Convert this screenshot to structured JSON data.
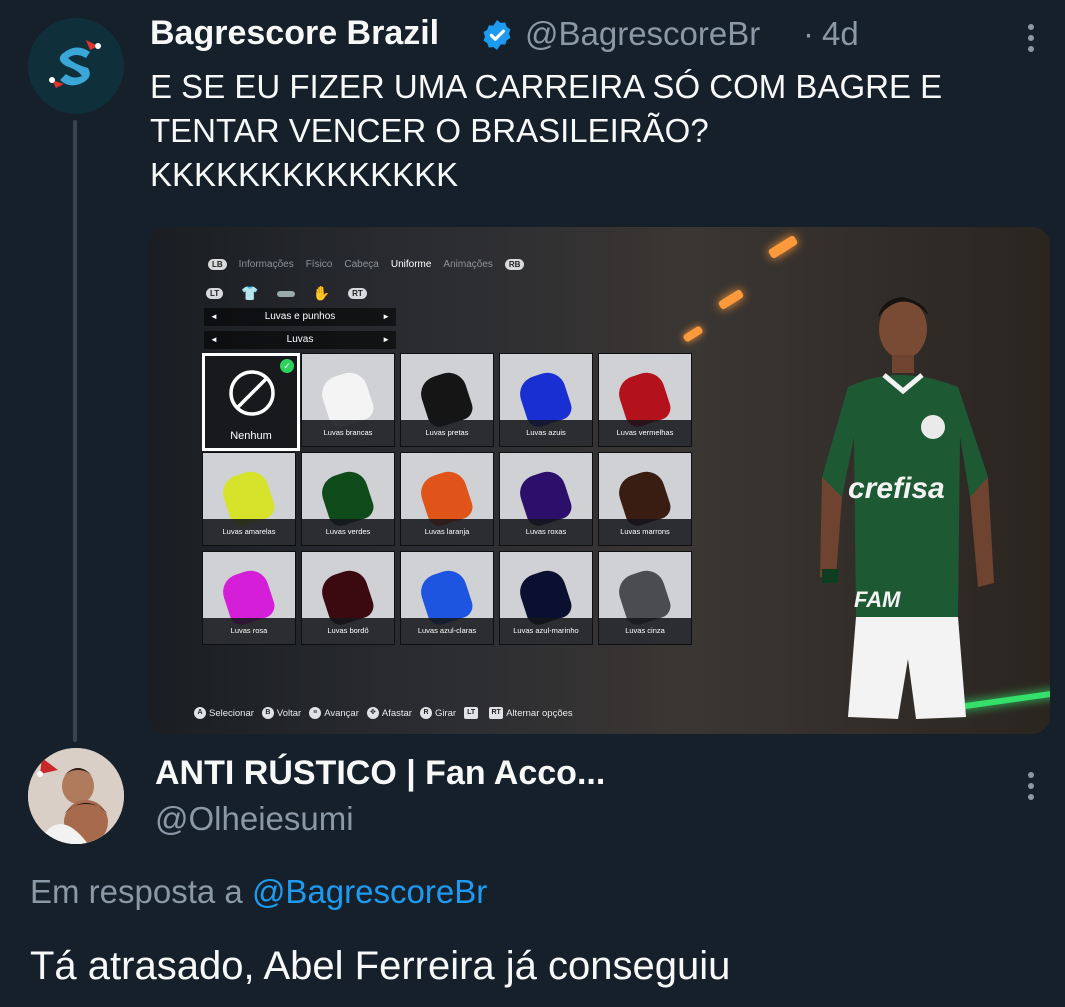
{
  "tweet": {
    "author_name": "Bagrescore Brazil",
    "handle": "@BagrescoreBr",
    "separator": "·",
    "time": "4d",
    "text_lines": [
      "E SE EU FIZER UMA CARREIRA SÓ COM BAGRE E",
      "TENTAR VENCER O BRASILEIRÃO?",
      "KKKKKKKKKKKKKK"
    ]
  },
  "game": {
    "tabs_left_button": "LB",
    "tabs": [
      "Informações",
      "Físico",
      "Cabeça",
      "Uniforme",
      "Animações"
    ],
    "active_tab": "Uniforme",
    "tabs_right_button": "RB",
    "category_left_button": "LT",
    "category_right_button": "RT",
    "selector1": "Luvas e punhos",
    "selector2": "Luvas",
    "tiles": [
      {
        "label": "Nenhum",
        "color": "none"
      },
      {
        "label": "Luvas brancas",
        "color": "#f4f4f4"
      },
      {
        "label": "Luvas pretas",
        "color": "#151515"
      },
      {
        "label": "Luvas azuis",
        "color": "#1a2fd1"
      },
      {
        "label": "Luvas vermelhas",
        "color": "#b3121c"
      },
      {
        "label": "Luvas amarelas",
        "color": "#d6e32a"
      },
      {
        "label": "Luvas verdes",
        "color": "#0f4a1a"
      },
      {
        "label": "Luvas laranja",
        "color": "#e0541a"
      },
      {
        "label": "Luvas roxas",
        "color": "#2b0f6b"
      },
      {
        "label": "Luvas marrons",
        "color": "#3a1d12"
      },
      {
        "label": "Luvas rosa",
        "color": "#d41ed8"
      },
      {
        "label": "Luvas bordô",
        "color": "#3a0a10"
      },
      {
        "label": "Luvas azul-claras",
        "color": "#1e55e0"
      },
      {
        "label": "Luvas azul-marinho",
        "color": "#0c1030"
      },
      {
        "label": "Luvas cinza",
        "color": "#4a4c50"
      }
    ],
    "legend": [
      {
        "icon": "A",
        "label": "Selecionar"
      },
      {
        "icon": "B",
        "label": "Voltar"
      },
      {
        "icon": "≡",
        "label": "Avançar"
      },
      {
        "icon": "✥",
        "label": "Afastar"
      },
      {
        "icon": "R",
        "label": "Girar"
      },
      {
        "icon": "LT",
        "label": ""
      },
      {
        "icon": "RT",
        "label": "Alternar opções"
      }
    ],
    "jersey_sponsor": "crefisa",
    "jersey_sponsor2": "FAM"
  },
  "reply": {
    "author_name": "ANTI RÚSTICO | Fan Acco...",
    "handle": "@Olheiesumi",
    "in_reply_prefix": "Em resposta a",
    "in_reply_handle": "@BagrescoreBr",
    "text": "Tá atrasado, Abel Ferreira já conseguiu"
  },
  "colors": {
    "background": "#15202b",
    "link": "#1d9bf0",
    "muted": "#8b98a5",
    "verified": "#1d9bf0"
  }
}
